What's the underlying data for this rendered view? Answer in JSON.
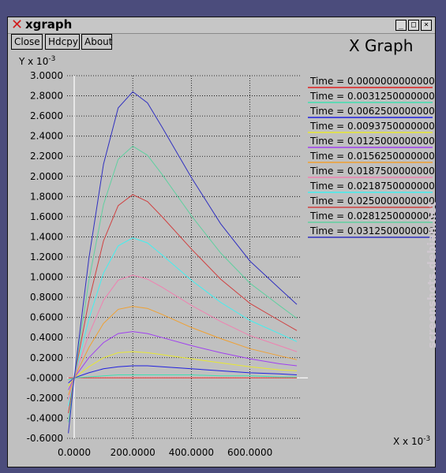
{
  "window": {
    "title": "xgraph",
    "buttons": {
      "minimize": "_",
      "maximize": "□",
      "close": "×"
    }
  },
  "toolbar": {
    "close_label": "Close",
    "hdcpy_label": "Hdcpy",
    "about_label": "About"
  },
  "graph_title": "X Graph",
  "watermark": "screenshots.debian.net",
  "chart_data": {
    "type": "line",
    "title": "X Graph",
    "ylabel": "Y x 10",
    "ylabel_exp": "-3",
    "xlabel": "X x 10",
    "xlabel_exp": "-3",
    "xlim": [
      -100,
      760
    ],
    "ylim": [
      -0.6,
      3.0
    ],
    "x_ticks": [
      0,
      200,
      400,
      600
    ],
    "x_tick_labels": [
      "0.0000",
      "200.0000",
      "400.0000",
      "600.0000"
    ],
    "y_ticks": [
      -0.6,
      -0.4,
      -0.2,
      0.0,
      0.2,
      0.4,
      0.6,
      0.8,
      1.0,
      1.2,
      1.4,
      1.6,
      1.8,
      2.0,
      2.2,
      2.4,
      2.6,
      2.8,
      3.0
    ],
    "y_tick_labels": [
      "-0.6000",
      "-0.4000",
      "-0.2000",
      "-0.0000",
      "0.2000",
      "0.4000",
      "0.6000",
      "0.8000",
      "1.0000",
      "1.2000",
      "1.4000",
      "1.6000",
      "1.8000",
      "2.0000",
      "2.2000",
      "2.4000",
      "2.6000",
      "2.8000",
      "3.0000"
    ],
    "grid": true,
    "legend_placement": "top-right",
    "x": [
      -20,
      0,
      50,
      100,
      150,
      200,
      250,
      300,
      400,
      500,
      600,
      700,
      760
    ],
    "series": [
      {
        "name": "Time = 0.0000000000000",
        "color": "#e02020",
        "values": [
          0.0,
          0.0,
          0.0,
          0.0,
          0.0,
          0.0,
          0.0,
          0.0,
          0.0,
          0.0,
          0.0,
          0.0,
          0.0
        ]
      },
      {
        "name": "Time = 0.0031250000000",
        "color": "#40e0b0",
        "values": [
          -0.02,
          0.0,
          0.01,
          0.02,
          0.03,
          0.03,
          0.03,
          0.03,
          0.03,
          0.02,
          0.02,
          0.01,
          0.01
        ]
      },
      {
        "name": "Time = 0.0062500000000",
        "color": "#2020e0",
        "values": [
          -0.05,
          0.0,
          0.05,
          0.09,
          0.11,
          0.12,
          0.12,
          0.11,
          0.09,
          0.07,
          0.05,
          0.04,
          0.03
        ]
      },
      {
        "name": "Time = 0.0093750000000",
        "color": "#e8e830",
        "values": [
          -0.08,
          0.0,
          0.11,
          0.2,
          0.25,
          0.26,
          0.25,
          0.23,
          0.19,
          0.15,
          0.11,
          0.08,
          0.07
        ]
      },
      {
        "name": "Time = 0.0125000000000",
        "color": "#a040f0",
        "values": [
          -0.12,
          0.0,
          0.2,
          0.35,
          0.44,
          0.46,
          0.44,
          0.4,
          0.32,
          0.25,
          0.19,
          0.14,
          0.12
        ]
      },
      {
        "name": "Time = 0.0156250000000",
        "color": "#f0a030",
        "values": [
          -0.17,
          0.0,
          0.3,
          0.54,
          0.68,
          0.71,
          0.69,
          0.63,
          0.5,
          0.39,
          0.29,
          0.22,
          0.18
        ]
      },
      {
        "name": "Time = 0.0187500000000",
        "color": "#f080b0",
        "values": [
          -0.22,
          0.0,
          0.43,
          0.77,
          0.97,
          1.02,
          0.98,
          0.9,
          0.72,
          0.56,
          0.42,
          0.32,
          0.26
        ]
      },
      {
        "name": "Time = 0.0218750000000",
        "color": "#40f0f0",
        "values": [
          -0.28,
          0.0,
          0.58,
          1.04,
          1.31,
          1.39,
          1.34,
          1.22,
          0.97,
          0.75,
          0.57,
          0.44,
          0.36
        ]
      },
      {
        "name": "Time = 0.0250000000000",
        "color": "#d04040",
        "values": [
          -0.35,
          0.0,
          0.76,
          1.36,
          1.71,
          1.82,
          1.75,
          1.6,
          1.28,
          0.98,
          0.74,
          0.57,
          0.47
        ]
      },
      {
        "name": "Time = 0.0281250000000",
        "color": "#60d0a0",
        "values": [
          -0.44,
          0.0,
          0.96,
          1.72,
          2.17,
          2.3,
          2.21,
          2.02,
          1.61,
          1.24,
          0.94,
          0.72,
          0.59
        ]
      },
      {
        "name": "Time = 0.0312500000000",
        "color": "#3030c0",
        "values": [
          -0.55,
          0.0,
          1.18,
          2.12,
          2.68,
          2.84,
          2.73,
          2.49,
          1.99,
          1.53,
          1.16,
          0.89,
          0.73
        ]
      }
    ]
  }
}
